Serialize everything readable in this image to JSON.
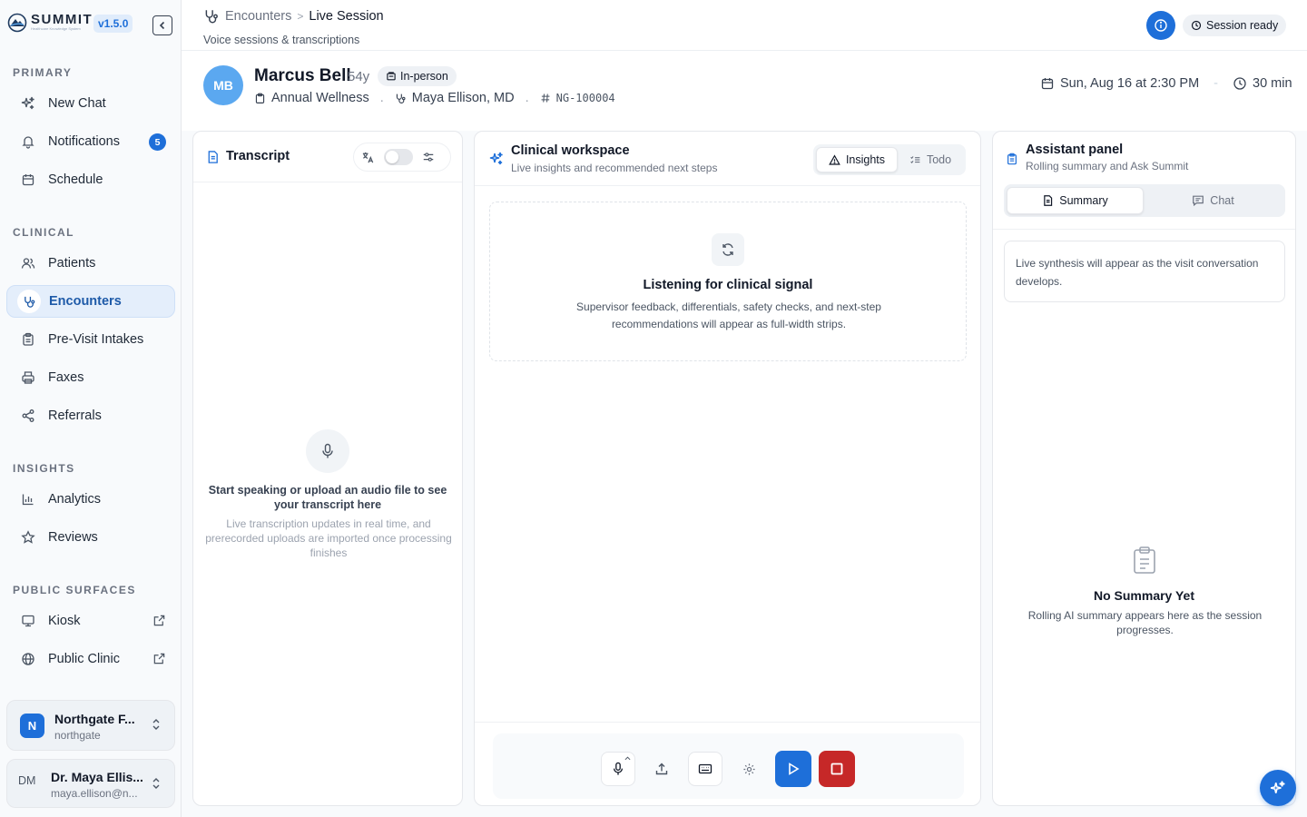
{
  "app": {
    "brand": "SUMMIT",
    "brand_tagline": "Healthcare Knowledge System",
    "version": "v1.5.0"
  },
  "sidebar": {
    "sections": [
      {
        "label": "PRIMARY"
      },
      {
        "label": "CLINICAL"
      },
      {
        "label": "INSIGHTS"
      },
      {
        "label": "PUBLIC SURFACES"
      }
    ],
    "items": [
      {
        "label": "New Chat",
        "icon": "sparkles-icon"
      },
      {
        "label": "Notifications",
        "icon": "bell-icon",
        "badge": "5"
      },
      {
        "label": "Schedule",
        "icon": "calendar-icon"
      },
      {
        "label": "Patients",
        "icon": "users-icon"
      },
      {
        "label": "Encounters",
        "icon": "stethoscope-icon",
        "active": true
      },
      {
        "label": "Pre-Visit Intakes",
        "icon": "clipboard-icon"
      },
      {
        "label": "Faxes",
        "icon": "printer-icon"
      },
      {
        "label": "Referrals",
        "icon": "share-icon"
      },
      {
        "label": "Analytics",
        "icon": "bar-chart-icon"
      },
      {
        "label": "Reviews",
        "icon": "star-icon"
      },
      {
        "label": "Kiosk",
        "icon": "monitor-icon",
        "external": true
      },
      {
        "label": "Public Clinic",
        "icon": "globe-icon",
        "external": true
      }
    ],
    "org": {
      "initial": "N",
      "name": "Northgate F...",
      "slug": "northgate"
    },
    "user": {
      "initials": "DM",
      "name": "Dr. Maya Ellis...",
      "email": "maya.ellison@n..."
    }
  },
  "header": {
    "breadcrumb_parent": "Encounters",
    "breadcrumb_sep": ">",
    "breadcrumb_current": "Live Session",
    "subtitle": "Voice sessions & transcriptions",
    "session_status": "Session ready"
  },
  "patient": {
    "initials": "MB",
    "name": "Marcus Bell",
    "age": "54y",
    "mode": "In-person",
    "visit_type": "Annual Wellness",
    "sep": ".",
    "provider": "Maya Ellison, MD",
    "record_id": "NG-100004",
    "datetime": "Sun, Aug 16 at 2:30 PM",
    "right_sep": "-",
    "duration": "30 min"
  },
  "transcript": {
    "title": "Transcript",
    "empty_title": "Start speaking or upload an audio file to see your transcript here",
    "empty_sub": "Live transcription updates in real time, and prerecorded uploads are imported once processing finishes"
  },
  "workspace": {
    "title": "Clinical workspace",
    "subtitle": "Live insights and recommended next steps",
    "tabs": [
      {
        "label": "Insights",
        "active": true
      },
      {
        "label": "Todo"
      }
    ],
    "listening_title": "Listening for clinical signal",
    "listening_sub": "Supervisor feedback, differentials, safety checks, and next-step recommendations will appear as full-width strips."
  },
  "assistant": {
    "title": "Assistant panel",
    "subtitle": "Rolling summary and Ask Summit",
    "tabs": [
      {
        "label": "Summary",
        "active": true
      },
      {
        "label": "Chat"
      }
    ],
    "synthesis_note": "Live synthesis will appear as the visit conversation develops.",
    "empty_title": "No Summary Yet",
    "empty_sub": "Rolling AI summary appears here as the session progresses."
  },
  "colors": {
    "accent": "#1e6fd9",
    "stop": "#c62828",
    "active_nav_bg": "#e4eefb"
  }
}
